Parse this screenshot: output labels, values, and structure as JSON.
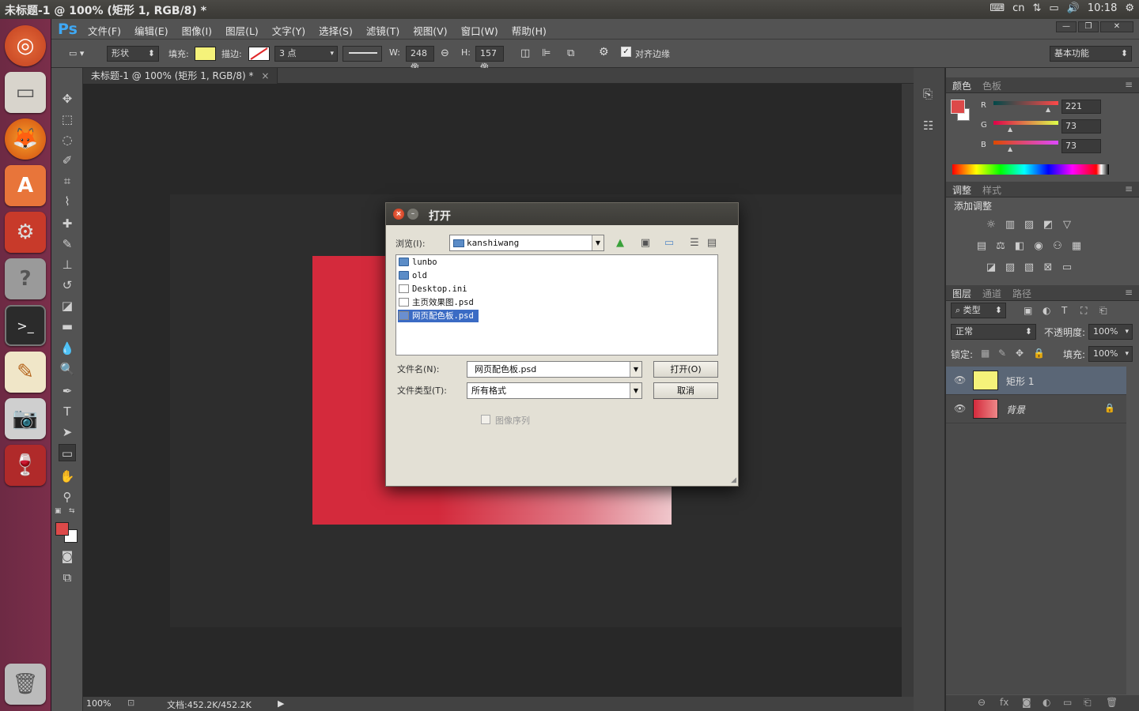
{
  "topbar": {
    "title": "未标题-1 @ 100% (矩形 1, RGB/8) *",
    "keyboard": "cn",
    "time": "10:18"
  },
  "menubar": {
    "logo": "Ps",
    "items": [
      "文件(F)",
      "编辑(E)",
      "图像(I)",
      "图层(L)",
      "文字(Y)",
      "选择(S)",
      "滤镜(T)",
      "视图(V)",
      "窗口(W)",
      "帮助(H)"
    ],
    "win_min": "—",
    "win_restore": "❐",
    "win_close": "✕"
  },
  "options": {
    "mode": "形状",
    "fill_label": "填充:",
    "fill_color": "#f5f27a",
    "stroke_label": "描边:",
    "stroke_size": "3 点",
    "w_label": "W:",
    "w_value": "248 像",
    "h_label": "H:",
    "h_value": "157 像",
    "align_edges": "对齐边缘",
    "workspace": "基本功能"
  },
  "document": {
    "tab_title": "未标题-1 @ 100% (矩形 1, RGB/8) *",
    "tab_close": "×"
  },
  "status": {
    "zoom": "100%",
    "doc_size": "文档:452.2K/452.2K"
  },
  "color_panel": {
    "tabs": [
      "颜色",
      "色板"
    ],
    "fg_color": "#dd4949",
    "r_label": "R",
    "g_label": "G",
    "b_label": "B",
    "r": "221",
    "g": "73",
    "b": "73"
  },
  "adjust_panel": {
    "tabs": [
      "调整",
      "样式"
    ],
    "heading": "添加调整"
  },
  "layers_panel": {
    "tabs": [
      "图层",
      "通道",
      "路径"
    ],
    "filter_kind": "类型",
    "blend_mode": "正常",
    "opacity_label": "不透明度:",
    "opacity": "100%",
    "lock_label": "锁定:",
    "fill_label": "填充:",
    "fill": "100%",
    "layers": [
      {
        "name": "矩形 1",
        "thumb_color": "#f5f27a"
      },
      {
        "name": "背景",
        "thumb_color": "#d42a3c"
      }
    ]
  },
  "dialog": {
    "title": "打开",
    "look_in_label": "浏览(I):",
    "look_in_value": "kanshiwang",
    "files": [
      {
        "name": "lunbo",
        "type": "folder"
      },
      {
        "name": "old",
        "type": "folder"
      },
      {
        "name": "Desktop.ini",
        "type": "file"
      },
      {
        "name": "主页效果图.psd",
        "type": "file"
      },
      {
        "name": "网页配色板.psd",
        "type": "file",
        "selected": true
      }
    ],
    "filename_label": "文件名(N):",
    "filename_value": "网页配色板.psd",
    "filetype_label": "文件类型(T):",
    "filetype_value": "所有格式",
    "open_button": "打开(O)",
    "cancel_button": "取消",
    "image_sequence": "图像序列"
  }
}
